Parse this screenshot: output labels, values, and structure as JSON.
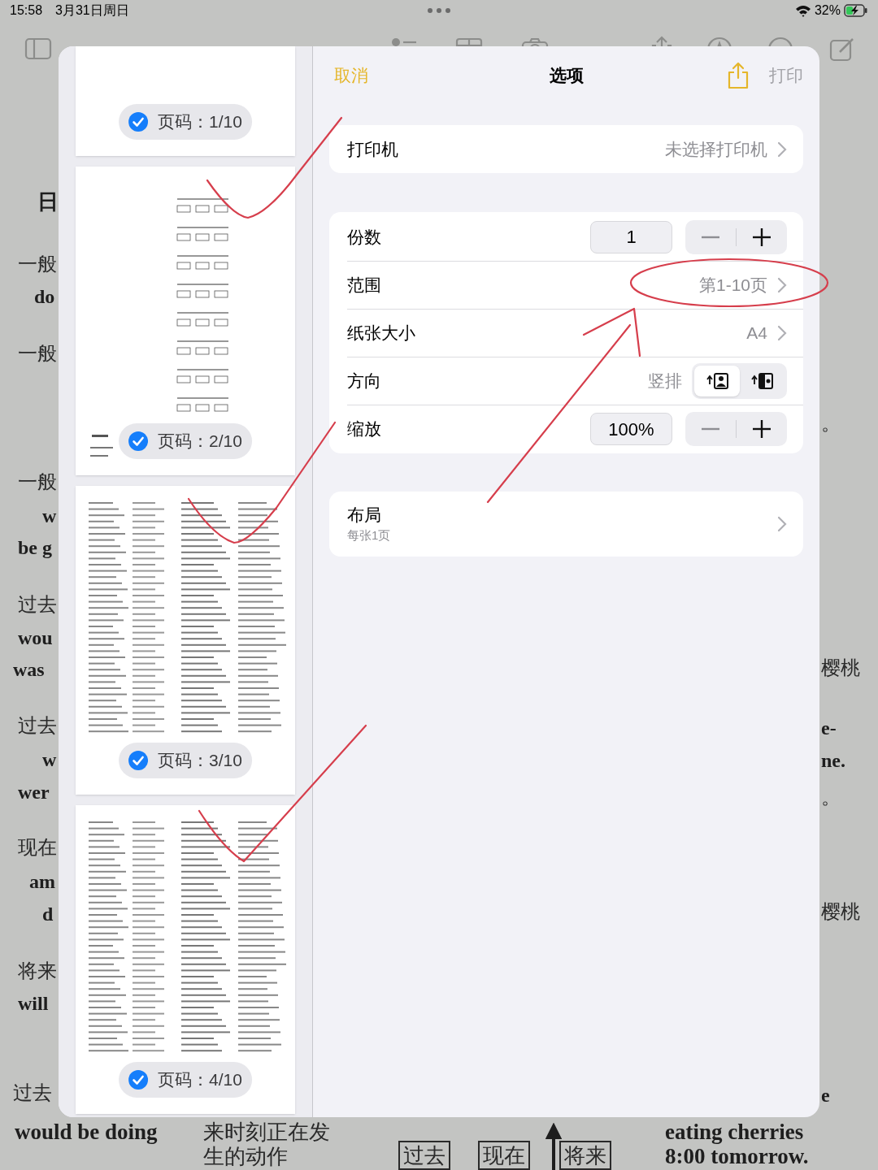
{
  "status_bar": {
    "time": "15:58",
    "date": "3月31日周日",
    "battery": "32%"
  },
  "background_document": {
    "left_fragments": [
      {
        "text": "日",
        "kind": "heading"
      },
      {
        "text": "一般",
        "kind": "zh"
      },
      {
        "text": "do",
        "kind": "en"
      },
      {
        "text": "一般",
        "kind": "zh"
      },
      {
        "text": "一般",
        "kind": "zh"
      },
      {
        "text": "w",
        "kind": "en"
      },
      {
        "text": "be g",
        "kind": "en"
      },
      {
        "text": "过去",
        "kind": "zh"
      },
      {
        "text": "wou",
        "kind": "en"
      },
      {
        "text": "was",
        "kind": "en"
      },
      {
        "text": "过去",
        "kind": "zh"
      },
      {
        "text": "w",
        "kind": "en"
      },
      {
        "text": "wer",
        "kind": "en"
      },
      {
        "text": "现在",
        "kind": "zh"
      },
      {
        "text": "am",
        "kind": "en"
      },
      {
        "text": "d",
        "kind": "en"
      },
      {
        "text": "将来",
        "kind": "zh"
      },
      {
        "text": "will",
        "kind": "en"
      },
      {
        "text": "过去",
        "kind": "zh"
      }
    ],
    "right_fragments": [
      {
        "text": "。",
        "kind": "zh"
      },
      {
        "text": "樱桃",
        "kind": "zh"
      },
      {
        "text": "e-",
        "kind": "en"
      },
      {
        "text": "ne.",
        "kind": "en"
      },
      {
        "text": "。",
        "kind": "zh"
      },
      {
        "text": "樱桃",
        "kind": "zh"
      },
      {
        "text": "e",
        "kind": "en"
      }
    ],
    "bottom_fragments": [
      {
        "text": "would be doing",
        "kind": "en"
      },
      {
        "text": "来时刻正在发",
        "kind": "zh"
      },
      {
        "text": "生的动作",
        "kind": "zh"
      },
      {
        "text": "eating cherries",
        "kind": "en"
      },
      {
        "text": "8:00 tomorrow.",
        "kind": "en"
      }
    ],
    "timeline_labels": [
      "过去",
      "现在",
      "将来"
    ]
  },
  "print_dialog": {
    "cancel": "取消",
    "title": "选项",
    "print": {
      "label": "打印",
      "disabled": true
    },
    "pages": [
      {
        "label": "页码：1/10",
        "selected": true
      },
      {
        "label": "页码：2/10",
        "selected": true
      },
      {
        "label": "页码：3/10",
        "selected": true
      },
      {
        "label": "页码：4/10",
        "selected": true
      }
    ],
    "printer": {
      "label": "打印机",
      "value": "未选择打印机"
    },
    "copies": {
      "label": "份数",
      "value": "1"
    },
    "range": {
      "label": "范围",
      "value": "第1-10页"
    },
    "paper_size": {
      "label": "纸张大小",
      "value": "A4"
    },
    "orientation": {
      "label": "方向",
      "value": "竖排",
      "options": [
        {
          "kind": "portrait",
          "selected": true
        },
        {
          "kind": "landscape",
          "selected": false
        }
      ]
    },
    "scale": {
      "label": "缩放",
      "value": "100%"
    },
    "layout": {
      "label": "布局",
      "subtitle": "每张1页"
    }
  }
}
